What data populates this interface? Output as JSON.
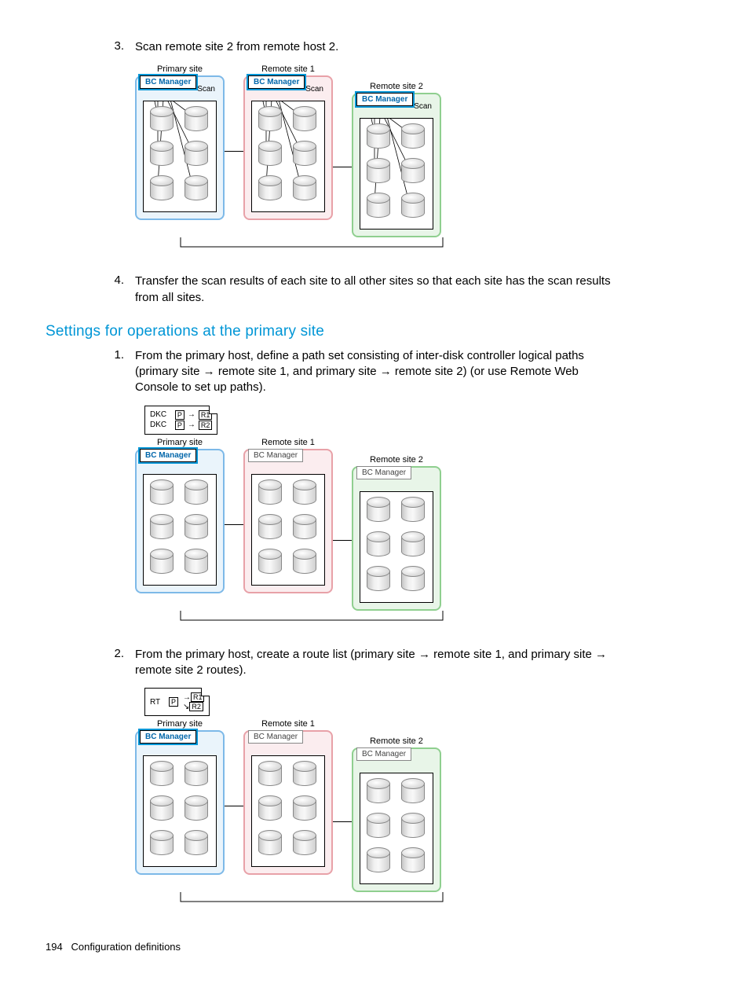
{
  "list": {
    "item3": {
      "num": "3.",
      "text": "Scan remote site 2 from remote host 2."
    },
    "item4": {
      "num": "4.",
      "text": "Transfer the scan results of each site to all other sites so that each site has the scan results from all sites."
    }
  },
  "heading": "Settings for operations at the primary site",
  "list2": {
    "item1": {
      "num": "1.",
      "text": "From the primary host, define a path set consisting of inter-disk controller logical paths (primary site → remote site 1, and primary site → remote site 2) (or use Remote Web Console to set up paths)."
    },
    "item2": {
      "num": "2.",
      "text": "From the primary host, create a route list (primary site → remote site 1, and primary site → remote site 2 routes)."
    }
  },
  "diagram": {
    "primary_label": "Primary site",
    "remote1_label": "Remote site 1",
    "remote2_label": "Remote site 2",
    "bc": "BC Manager",
    "scan": "Scan"
  },
  "legend1": {
    "title": "DKC",
    "p": "P",
    "r1": "R1",
    "r2": "R2"
  },
  "legend2": {
    "title": "RT",
    "p": "P",
    "r1": "R1",
    "r2": "R2"
  },
  "footer": {
    "page": "194",
    "section": "Configuration definitions"
  }
}
